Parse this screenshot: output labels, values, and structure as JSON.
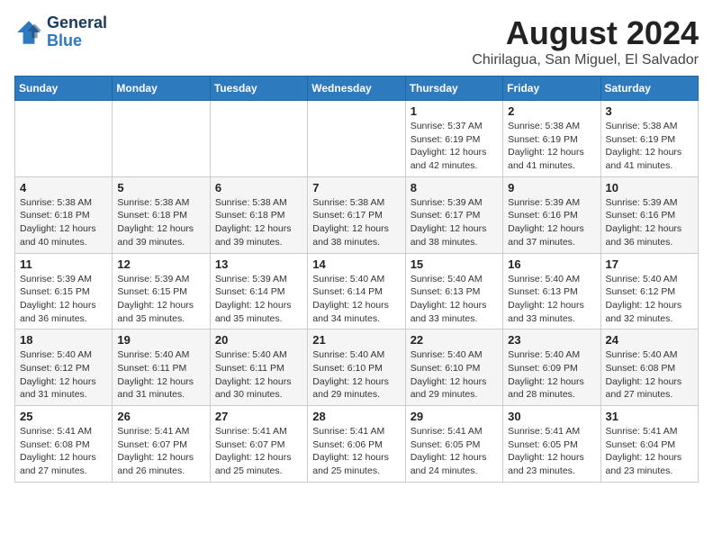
{
  "header": {
    "logo_line1": "General",
    "logo_line2": "Blue",
    "title": "August 2024",
    "subtitle": "Chirilagua, San Miguel, El Salvador"
  },
  "days_of_week": [
    "Sunday",
    "Monday",
    "Tuesday",
    "Wednesday",
    "Thursday",
    "Friday",
    "Saturday"
  ],
  "weeks": [
    [
      {
        "day": "",
        "info": ""
      },
      {
        "day": "",
        "info": ""
      },
      {
        "day": "",
        "info": ""
      },
      {
        "day": "",
        "info": ""
      },
      {
        "day": "1",
        "info": "Sunrise: 5:37 AM\nSunset: 6:19 PM\nDaylight: 12 hours\nand 42 minutes."
      },
      {
        "day": "2",
        "info": "Sunrise: 5:38 AM\nSunset: 6:19 PM\nDaylight: 12 hours\nand 41 minutes."
      },
      {
        "day": "3",
        "info": "Sunrise: 5:38 AM\nSunset: 6:19 PM\nDaylight: 12 hours\nand 41 minutes."
      }
    ],
    [
      {
        "day": "4",
        "info": "Sunrise: 5:38 AM\nSunset: 6:18 PM\nDaylight: 12 hours\nand 40 minutes."
      },
      {
        "day": "5",
        "info": "Sunrise: 5:38 AM\nSunset: 6:18 PM\nDaylight: 12 hours\nand 39 minutes."
      },
      {
        "day": "6",
        "info": "Sunrise: 5:38 AM\nSunset: 6:18 PM\nDaylight: 12 hours\nand 39 minutes."
      },
      {
        "day": "7",
        "info": "Sunrise: 5:38 AM\nSunset: 6:17 PM\nDaylight: 12 hours\nand 38 minutes."
      },
      {
        "day": "8",
        "info": "Sunrise: 5:39 AM\nSunset: 6:17 PM\nDaylight: 12 hours\nand 38 minutes."
      },
      {
        "day": "9",
        "info": "Sunrise: 5:39 AM\nSunset: 6:16 PM\nDaylight: 12 hours\nand 37 minutes."
      },
      {
        "day": "10",
        "info": "Sunrise: 5:39 AM\nSunset: 6:16 PM\nDaylight: 12 hours\nand 36 minutes."
      }
    ],
    [
      {
        "day": "11",
        "info": "Sunrise: 5:39 AM\nSunset: 6:15 PM\nDaylight: 12 hours\nand 36 minutes."
      },
      {
        "day": "12",
        "info": "Sunrise: 5:39 AM\nSunset: 6:15 PM\nDaylight: 12 hours\nand 35 minutes."
      },
      {
        "day": "13",
        "info": "Sunrise: 5:39 AM\nSunset: 6:14 PM\nDaylight: 12 hours\nand 35 minutes."
      },
      {
        "day": "14",
        "info": "Sunrise: 5:40 AM\nSunset: 6:14 PM\nDaylight: 12 hours\nand 34 minutes."
      },
      {
        "day": "15",
        "info": "Sunrise: 5:40 AM\nSunset: 6:13 PM\nDaylight: 12 hours\nand 33 minutes."
      },
      {
        "day": "16",
        "info": "Sunrise: 5:40 AM\nSunset: 6:13 PM\nDaylight: 12 hours\nand 33 minutes."
      },
      {
        "day": "17",
        "info": "Sunrise: 5:40 AM\nSunset: 6:12 PM\nDaylight: 12 hours\nand 32 minutes."
      }
    ],
    [
      {
        "day": "18",
        "info": "Sunrise: 5:40 AM\nSunset: 6:12 PM\nDaylight: 12 hours\nand 31 minutes."
      },
      {
        "day": "19",
        "info": "Sunrise: 5:40 AM\nSunset: 6:11 PM\nDaylight: 12 hours\nand 31 minutes."
      },
      {
        "day": "20",
        "info": "Sunrise: 5:40 AM\nSunset: 6:11 PM\nDaylight: 12 hours\nand 30 minutes."
      },
      {
        "day": "21",
        "info": "Sunrise: 5:40 AM\nSunset: 6:10 PM\nDaylight: 12 hours\nand 29 minutes."
      },
      {
        "day": "22",
        "info": "Sunrise: 5:40 AM\nSunset: 6:10 PM\nDaylight: 12 hours\nand 29 minutes."
      },
      {
        "day": "23",
        "info": "Sunrise: 5:40 AM\nSunset: 6:09 PM\nDaylight: 12 hours\nand 28 minutes."
      },
      {
        "day": "24",
        "info": "Sunrise: 5:40 AM\nSunset: 6:08 PM\nDaylight: 12 hours\nand 27 minutes."
      }
    ],
    [
      {
        "day": "25",
        "info": "Sunrise: 5:41 AM\nSunset: 6:08 PM\nDaylight: 12 hours\nand 27 minutes."
      },
      {
        "day": "26",
        "info": "Sunrise: 5:41 AM\nSunset: 6:07 PM\nDaylight: 12 hours\nand 26 minutes."
      },
      {
        "day": "27",
        "info": "Sunrise: 5:41 AM\nSunset: 6:07 PM\nDaylight: 12 hours\nand 25 minutes."
      },
      {
        "day": "28",
        "info": "Sunrise: 5:41 AM\nSunset: 6:06 PM\nDaylight: 12 hours\nand 25 minutes."
      },
      {
        "day": "29",
        "info": "Sunrise: 5:41 AM\nSunset: 6:05 PM\nDaylight: 12 hours\nand 24 minutes."
      },
      {
        "day": "30",
        "info": "Sunrise: 5:41 AM\nSunset: 6:05 PM\nDaylight: 12 hours\nand 23 minutes."
      },
      {
        "day": "31",
        "info": "Sunrise: 5:41 AM\nSunset: 6:04 PM\nDaylight: 12 hours\nand 23 minutes."
      }
    ]
  ]
}
